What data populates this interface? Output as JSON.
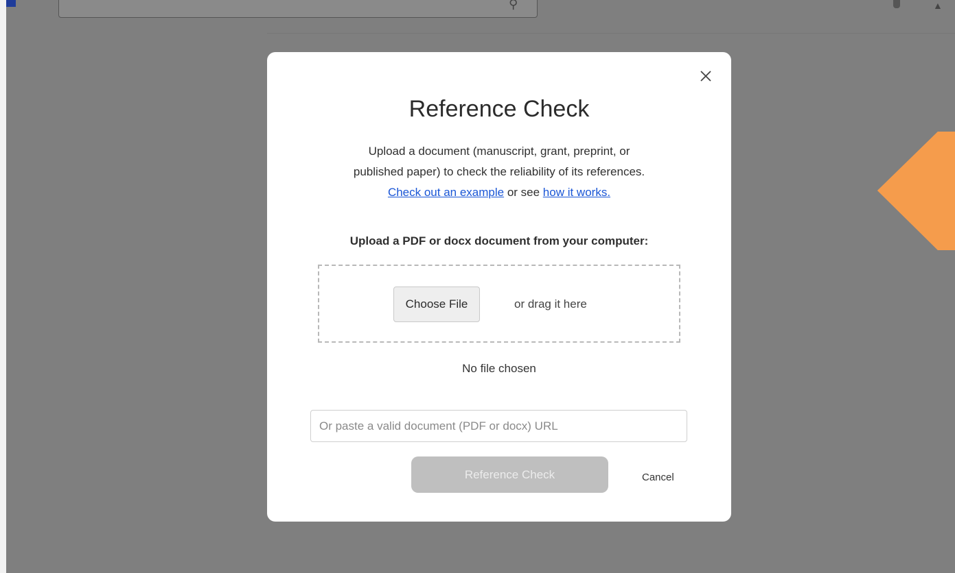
{
  "modal": {
    "title": "Reference Check",
    "description_line1": "Upload a document (manuscript, grant, preprint, or",
    "description_line2": "published paper) to check the reliability of its references.",
    "example_link": "Check out an example",
    "link_joiner": " or see ",
    "how_link": "how it works.",
    "upload_label": "Upload a PDF or docx document from your computer:",
    "choose_file_label": "Choose File",
    "drag_text": "or drag it here",
    "file_status": "No file chosen",
    "url_input": {
      "value": "",
      "placeholder": "Or paste a valid document (PDF or docx) URL"
    },
    "submit_label": "Reference Check",
    "cancel_label": "Cancel"
  },
  "icons": {
    "close": "close-icon",
    "arrow": "arrow-left-icon",
    "menu": "menu-icon",
    "search": "search-icon"
  },
  "colors": {
    "overlay": "#7f7f7f",
    "link": "#1a56d6",
    "arrow": "#f59c4c",
    "disabled_button": "#bfbfbf"
  }
}
